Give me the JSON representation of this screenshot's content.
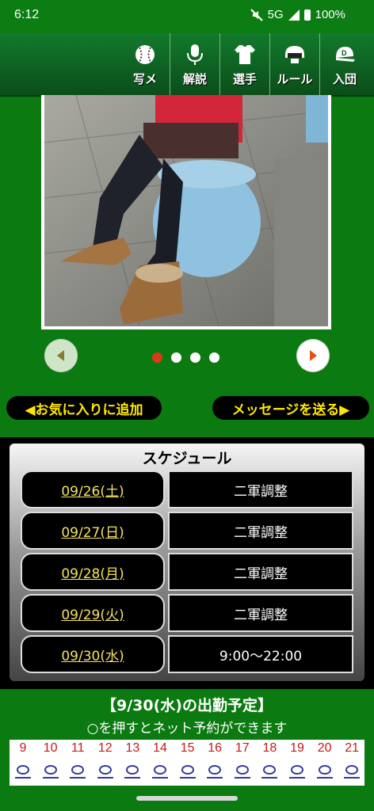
{
  "status_bar": {
    "time": "6:12",
    "network": "5G",
    "battery": "100%"
  },
  "nav": [
    {
      "label": "写メ",
      "icon": "baseball-icon"
    },
    {
      "label": "解説",
      "icon": "microphone-icon"
    },
    {
      "label": "選手",
      "icon": "jersey-icon"
    },
    {
      "label": "ルール",
      "icon": "helmet-icon"
    },
    {
      "label": "入団",
      "icon": "cap-icon"
    }
  ],
  "carousel": {
    "total": 4,
    "active_index": 0
  },
  "actions": {
    "favorite": "◀お気に入りに追加",
    "message": "メッセージを送る▶"
  },
  "schedule": {
    "title": "スケジュール",
    "rows": [
      {
        "date": "09/26(土)",
        "status": "二軍調整"
      },
      {
        "date": "09/27(日)",
        "status": "二軍調整"
      },
      {
        "date": "09/28(月)",
        "status": "二軍調整"
      },
      {
        "date": "09/29(火)",
        "status": "二軍調整"
      },
      {
        "date": "09/30(水)",
        "status": "9:00～22:00"
      }
    ]
  },
  "attendance": {
    "title": "【9/30(水)の出勤予定】",
    "subtitle": "○を押すとネット予約ができます",
    "hours": [
      "9",
      "10",
      "11",
      "12",
      "13",
      "14",
      "15",
      "16",
      "17",
      "18",
      "19",
      "20",
      "21"
    ]
  },
  "colors": {
    "background": "#0b7a10",
    "accent_yellow": "#f4e25c",
    "dot_active": "#d93b1e",
    "hour_red": "#c41a1a"
  }
}
